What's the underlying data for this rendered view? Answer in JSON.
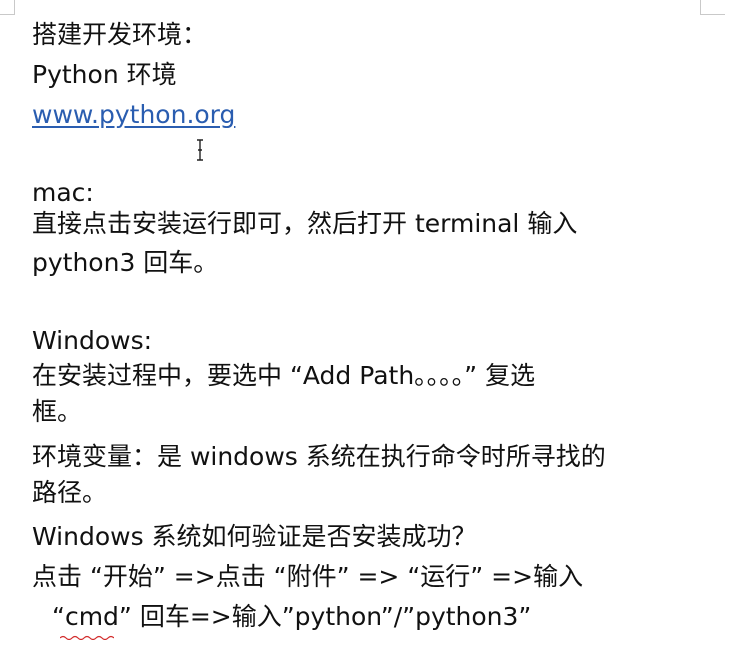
{
  "document": {
    "lines": [
      "搭建开发环境：",
      "Python 环境",
      "www.python.org",
      "mac:",
      "直接点击安装运行即可，然后打开 terminal 输入",
      "python3 回车。",
      "Windows:",
      "在安装过程中，要选中 “Add  Path。。。。” 复选",
      "框。",
      "环境变量：是 windows 系统在执行命令时所寻找的",
      "路径。",
      "Windows 系统如何验证是否安装成功？",
      "点击 “开始” =>点击 “附件” => “运行” =>输入",
      "“cmd” 回车=>输入”python”/”python3”"
    ]
  },
  "colors": {
    "text": "#111111",
    "link": "#2a5db0",
    "spellcheck_squiggle": "#d22b2b"
  },
  "icons": {
    "cursor": "text-cursor-icon"
  }
}
